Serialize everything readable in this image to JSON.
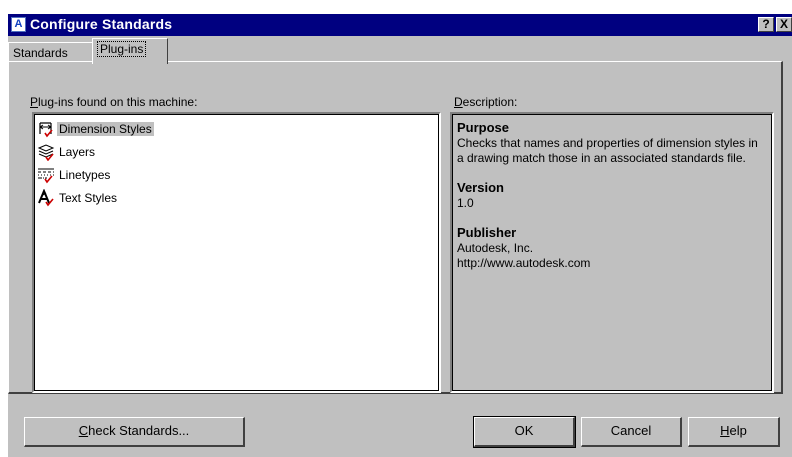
{
  "window": {
    "title": "Configure Standards",
    "help_button": "?",
    "close_button": "X"
  },
  "tabs": [
    {
      "label": "Standards",
      "active": false
    },
    {
      "label": "Plug-ins",
      "active": true
    }
  ],
  "plugins": {
    "label_hotkey": "P",
    "label_rest": "lug-ins found on this machine:",
    "items": [
      {
        "label": "Dimension Styles",
        "icon": "dimension-styles-icon",
        "selected": true
      },
      {
        "label": "Layers",
        "icon": "layers-icon",
        "selected": false
      },
      {
        "label": "Linetypes",
        "icon": "linetypes-icon",
        "selected": false
      },
      {
        "label": "Text Styles",
        "icon": "text-styles-icon",
        "selected": false
      }
    ]
  },
  "description": {
    "label_hotkey": "D",
    "label_rest": "escription:",
    "purpose_heading": "Purpose",
    "purpose_text": "Checks that names and properties of dimension styles in a drawing match those in an associated standards file.",
    "version_heading": "Version",
    "version_text": "1.0",
    "publisher_heading": "Publisher",
    "publisher_name": "Autodesk, Inc.",
    "publisher_url": "http://www.autodesk.com"
  },
  "buttons": {
    "check_hotkey": "C",
    "check_rest": "heck Standards...",
    "ok": "OK",
    "cancel": "Cancel",
    "help_hotkey": "H",
    "help_rest": "elp"
  },
  "colors": {
    "titlebar": "#000080",
    "dialog": "#c0c0c0",
    "icon_check": "#cc0000"
  }
}
